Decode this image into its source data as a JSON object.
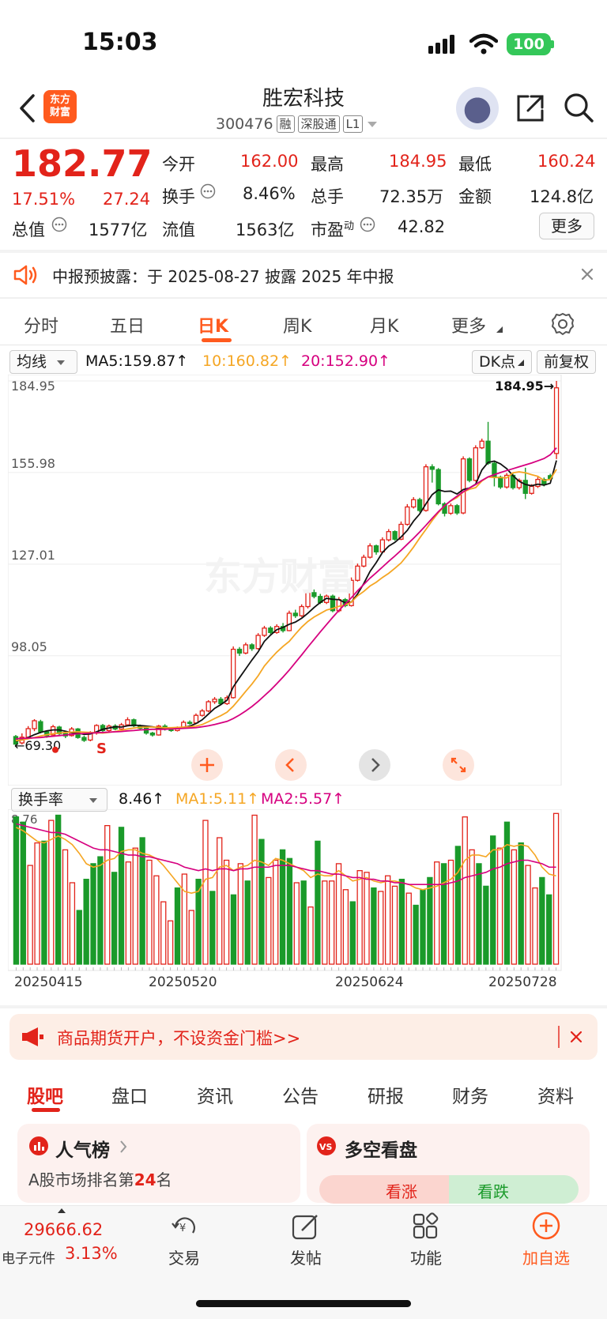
{
  "status": {
    "time": "15:03",
    "battery": "100"
  },
  "header": {
    "logo_text": "东方财富",
    "stock_name": "胜宏科技",
    "stock_code": "300476",
    "tags": [
      "融",
      "深股通",
      "L1"
    ]
  },
  "quote": {
    "price": "182.77",
    "change_pct": "17.51%",
    "change_amt": "27.24",
    "fields": [
      {
        "label": "今开",
        "value": "162.00",
        "color": "red"
      },
      {
        "label": "最高",
        "value": "184.95",
        "color": "red"
      },
      {
        "label": "最低",
        "value": "160.24",
        "color": "red"
      },
      {
        "label": "换手",
        "value": "8.46%",
        "color": "black"
      },
      {
        "label": "总手",
        "value": "72.35万",
        "color": "black"
      },
      {
        "label": "金额",
        "value": "124.8亿",
        "color": "black"
      },
      {
        "label": "总值",
        "value": "1577亿",
        "color": "black"
      },
      {
        "label": "流值",
        "value": "1563亿",
        "color": "black"
      },
      {
        "label": "市盈",
        "value": "42.82",
        "color": "black"
      }
    ],
    "pe_superscript": "动",
    "more_label": "更多"
  },
  "notice": {
    "text": "中报预披露：于 2025-08-27 披露 2025 年中报"
  },
  "kline_tabs": [
    "分时",
    "五日",
    "日K",
    "周K",
    "月K",
    "更多"
  ],
  "kline_active": 2,
  "ma_row": {
    "ma_select": "均线",
    "ma5": "MA5:159.87↑",
    "ma10": "10:160.82↑",
    "ma20": "20:152.90↑",
    "dk_label": "DK点",
    "adjust_label": "前复权"
  },
  "colors": {
    "up": "#e2231a",
    "down": "#1a9a2a",
    "ma5": "#111111",
    "ma10": "#f5a623",
    "ma20": "#d6007f",
    "accent": "#ff5a1e"
  },
  "chart_data": [
    {
      "type": "candlestick",
      "y_ticks": [
        "184.95",
        "155.98",
        "127.01",
        "98.05"
      ],
      "ylim": [
        70.0,
        184.95
      ],
      "max_label": "184.95→",
      "min_label": "69.30",
      "min_label_prefix": "←",
      "ohlc": [
        [
          72.5,
          70.1,
          73.0,
          69.3
        ],
        [
          70.5,
          72.3,
          73.5,
          70.0
        ],
        [
          72.3,
          75.0,
          75.8,
          71.6
        ],
        [
          75.0,
          77.5,
          78.0,
          74.2
        ],
        [
          77.2,
          74.0,
          77.8,
          73.5
        ],
        [
          74.0,
          72.8,
          74.5,
          72.1
        ],
        [
          73.0,
          75.6,
          76.2,
          72.6
        ],
        [
          75.5,
          73.4,
          75.9,
          72.9
        ],
        [
          73.4,
          72.7,
          74.0,
          72.0
        ],
        [
          72.8,
          74.9,
          75.5,
          72.5
        ],
        [
          74.9,
          72.2,
          75.2,
          71.8
        ],
        [
          72.2,
          71.3,
          72.8,
          70.8
        ],
        [
          71.4,
          73.6,
          74.2,
          71.0
        ],
        [
          73.6,
          76.0,
          76.4,
          73.1
        ],
        [
          76.0,
          74.4,
          76.5,
          74.0
        ],
        [
          74.4,
          75.8,
          76.3,
          74.0
        ],
        [
          75.8,
          74.9,
          76.4,
          74.5
        ],
        [
          74.9,
          76.2,
          76.8,
          74.6
        ],
        [
          76.2,
          77.8,
          78.6,
          75.8
        ],
        [
          77.8,
          75.9,
          78.2,
          75.5
        ],
        [
          75.9,
          75.1,
          76.3,
          74.6
        ],
        [
          75.1,
          73.6,
          75.5,
          73.1
        ],
        [
          73.6,
          73.0,
          74.0,
          72.5
        ],
        [
          73.0,
          75.8,
          76.2,
          72.8
        ],
        [
          75.8,
          74.9,
          76.4,
          74.4
        ],
        [
          74.9,
          74.4,
          75.4,
          74.0
        ],
        [
          74.4,
          75.3,
          75.7,
          74.1
        ],
        [
          75.3,
          77.0,
          77.6,
          75.0
        ],
        [
          77.0,
          76.8,
          77.6,
          76.2
        ],
        [
          76.8,
          79.2,
          79.8,
          76.6
        ],
        [
          79.2,
          80.6,
          81.2,
          78.8
        ],
        [
          80.6,
          83.5,
          84.0,
          80.2
        ],
        [
          83.5,
          84.3,
          85.0,
          82.8
        ],
        [
          84.3,
          82.9,
          85.0,
          82.4
        ],
        [
          82.9,
          84.8,
          85.5,
          82.5
        ],
        [
          84.8,
          100.1,
          101.0,
          84.5
        ],
        [
          100.1,
          98.9,
          100.8,
          98.0
        ],
        [
          98.9,
          101.5,
          102.2,
          98.5
        ],
        [
          101.5,
          100.3,
          102.0,
          99.6
        ],
        [
          100.3,
          104.5,
          105.2,
          100.0
        ],
        [
          104.5,
          106.8,
          107.5,
          104.0
        ],
        [
          106.8,
          105.4,
          107.4,
          104.9
        ],
        [
          105.4,
          107.3,
          108.0,
          105.0
        ],
        [
          107.3,
          106.0,
          108.4,
          105.4
        ],
        [
          106.0,
          111.5,
          112.3,
          105.8
        ],
        [
          111.5,
          110.7,
          112.6,
          110.0
        ],
        [
          110.7,
          113.6,
          114.3,
          110.3
        ],
        [
          113.6,
          118.0,
          118.8,
          113.0
        ],
        [
          118.0,
          116.8,
          119.0,
          116.2
        ],
        [
          116.8,
          114.9,
          117.6,
          114.4
        ],
        [
          114.9,
          116.9,
          117.4,
          114.4
        ],
        [
          116.9,
          112.3,
          117.4,
          111.8
        ],
        [
          112.3,
          115.8,
          116.6,
          111.8
        ],
        [
          115.8,
          113.9,
          116.3,
          113.4
        ],
        [
          113.9,
          121.9,
          122.8,
          113.6
        ],
        [
          121.9,
          126.4,
          127.2,
          121.5
        ],
        [
          126.4,
          129.2,
          130.0,
          126.0
        ],
        [
          129.2,
          132.8,
          133.6,
          128.8
        ],
        [
          132.8,
          130.9,
          133.2,
          130.0
        ],
        [
          130.9,
          134.7,
          135.5,
          130.5
        ],
        [
          134.7,
          137.3,
          138.1,
          134.2
        ],
        [
          137.3,
          134.9,
          137.7,
          134.4
        ],
        [
          134.9,
          139.6,
          140.5,
          134.6
        ],
        [
          139.6,
          145.1,
          146.0,
          139.2
        ],
        [
          145.1,
          147.4,
          148.2,
          144.6
        ],
        [
          147.4,
          144.0,
          148.0,
          143.4
        ],
        [
          144.0,
          157.8,
          158.6,
          143.6
        ],
        [
          157.8,
          157.0,
          158.6,
          152.8
        ],
        [
          156.9,
          146.1,
          157.4,
          145.6
        ],
        [
          146.1,
          143.1,
          146.6,
          142.1
        ],
        [
          143.1,
          145.5,
          146.2,
          142.6
        ],
        [
          145.5,
          143.2,
          146.0,
          142.6
        ],
        [
          143.2,
          160.3,
          161.1,
          142.8
        ],
        [
          160.3,
          153.5,
          160.8,
          152.9
        ],
        [
          153.5,
          163.8,
          164.6,
          153.1
        ],
        [
          163.8,
          165.9,
          166.7,
          163.4
        ],
        [
          165.9,
          158.9,
          172.0,
          158.4
        ],
        [
          158.9,
          154.5,
          159.5,
          151.6
        ],
        [
          154.5,
          151.4,
          155.0,
          150.8
        ],
        [
          151.4,
          155.1,
          155.8,
          150.9
        ],
        [
          155.1,
          151.2,
          155.6,
          150.6
        ],
        [
          151.2,
          153.5,
          154.1,
          150.6
        ],
        [
          153.5,
          149.4,
          157.5,
          147.6
        ],
        [
          149.4,
          151.6,
          152.3,
          149.0
        ],
        [
          151.6,
          153.8,
          154.6,
          151.1
        ],
        [
          153.8,
          152.3,
          154.4,
          151.6
        ],
        [
          155.0,
          154.1,
          155.6,
          153.5
        ],
        [
          162.0,
          182.77,
          184.95,
          160.24
        ]
      ],
      "ma5": [
        71.0,
        71.5,
        72.2,
        73.1,
        73.8,
        74.3,
        74.6,
        74.6,
        74.2,
        73.7,
        73.6,
        73.2,
        73.3,
        74.0,
        74.8,
        75.2,
        75.6,
        75.5,
        75.9,
        76.1,
        76.0,
        75.8,
        75.6,
        75.2,
        75.1,
        75.0,
        75.2,
        75.4,
        75.8,
        76.6,
        77.8,
        79.6,
        81.4,
        82.6,
        84.0,
        88.2,
        91.1,
        93.9,
        96.7,
        99.3,
        102.6,
        104.6,
        106.3,
        107.0,
        108.0,
        108.7,
        109.9,
        111.5,
        113.3,
        114.9,
        116.2,
        115.9,
        115.8,
        114.8,
        115.0,
        117.6,
        120.9,
        124.7,
        127.5,
        130.7,
        132.7,
        133.9,
        135.6,
        137.7,
        140.6,
        142.9,
        146.1,
        149.0,
        150.5,
        150.0,
        150.1,
        149.2,
        150.6,
        151.1,
        152.3,
        156.8,
        159.2,
        159.6,
        158.7,
        157.2,
        155.0,
        153.2,
        152.2,
        151.8,
        152.3,
        152.0,
        152.6,
        159.8
      ],
      "ma10": [
        71.2,
        71.4,
        71.8,
        72.2,
        72.7,
        73.1,
        73.4,
        73.6,
        73.8,
        73.9,
        74.0,
        73.9,
        73.8,
        73.7,
        73.6,
        73.8,
        74.1,
        74.5,
        74.9,
        75.2,
        75.4,
        75.5,
        75.5,
        75.4,
        75.3,
        75.3,
        75.4,
        75.5,
        75.6,
        75.8,
        76.3,
        77.2,
        78.2,
        79.1,
        80.2,
        82.1,
        84.4,
        86.8,
        89.1,
        91.7,
        94.8,
        97.1,
        99.2,
        101.0,
        102.6,
        104.9,
        107.1,
        108.9,
        110.3,
        111.4,
        112.5,
        113.0,
        113.7,
        114.1,
        115.0,
        117.0,
        118.4,
        120.1,
        121.3,
        122.8,
        124.1,
        125.7,
        127.4,
        129.8,
        132.4,
        135.3,
        138.0,
        140.8,
        143.3,
        145.5,
        147.0,
        148.1,
        149.8,
        150.7,
        151.2,
        153.3,
        154.6,
        154.4,
        154.4,
        154.3,
        155.9,
        156.2,
        155.9,
        155.3,
        154.8,
        153.5,
        153.8,
        157.0
      ],
      "ma20": [
        71.8,
        71.9,
        72.0,
        72.1,
        72.2,
        72.4,
        72.6,
        72.8,
        73.0,
        73.2,
        73.4,
        73.5,
        73.6,
        73.7,
        73.8,
        73.9,
        74.0,
        74.1,
        74.3,
        74.4,
        74.6,
        74.7,
        74.8,
        74.8,
        74.8,
        74.9,
        75.0,
        75.1,
        75.2,
        75.3,
        75.6,
        75.9,
        76.3,
        76.8,
        77.3,
        78.2,
        79.3,
        80.6,
        82.0,
        83.6,
        85.4,
        87.2,
        89.2,
        91.3,
        93.5,
        95.9,
        98.3,
        100.8,
        103.2,
        105.6,
        107.9,
        110.2,
        112.4,
        114.4,
        116.4,
        118.6,
        120.6,
        122.6,
        124.3,
        126.1,
        127.9,
        129.6,
        131.4,
        133.3,
        135.2,
        137.2,
        139.3,
        141.5,
        143.6,
        145.5,
        147.1,
        148.5,
        149.9,
        151.1,
        152.2,
        153.5,
        154.6,
        155.3,
        156.0,
        156.6,
        157.2,
        157.8,
        158.4,
        159.0,
        159.7,
        160.4,
        161.6,
        163.8
      ]
    },
    {
      "type": "bar",
      "indicator_select": "换手率",
      "value_label": "8.46↑",
      "ma1_label": "MA1:5.11↑",
      "ma2_label": "MA2:5.57↑",
      "y_max_label": "8.76",
      "ylim": [
        0,
        8.76
      ],
      "x_labels": [
        "20250415",
        "20250520",
        "20250624",
        "20250728"
      ],
      "values": [
        8.5,
        8.2,
        5.7,
        7.0,
        7.1,
        8.3,
        8.6,
        6.6,
        4.7,
        3.1,
        4.9,
        5.8,
        6.2,
        8.0,
        5.3,
        7.9,
        5.9,
        6.7,
        7.3,
        6.0,
        5.1,
        3.6,
        2.5,
        4.4,
        5.2,
        3.1,
        4.9,
        8.3,
        4.2,
        7.3,
        6.0,
        4.0,
        5.8,
        4.8,
        8.6,
        7.2,
        5.0,
        6.0,
        6.6,
        6.1,
        4.7,
        4.8,
        3.3,
        7.1,
        4.8,
        4.8,
        5.8,
        4.3,
        3.6,
        5.4,
        5.3,
        4.4,
        4.2,
        5.1,
        4.5,
        4.9,
        4.1,
        3.4,
        4.3,
        5.0,
        5.9,
        5.8,
        6.0,
        6.8,
        8.5,
        6.6,
        5.8,
        4.5,
        7.4,
        6.7,
        8.2,
        6.6,
        7.0,
        5.7,
        4.4,
        5.0,
        4.0,
        8.7
      ],
      "ma1": [
        7.9,
        7.7,
        7.4,
        7.1,
        7.0,
        7.2,
        7.4,
        7.2,
        6.9,
        6.4,
        5.8,
        5.6,
        5.7,
        6.0,
        6.1,
        6.5,
        6.6,
        6.6,
        6.4,
        6.3,
        6.1,
        5.7,
        5.2,
        4.7,
        4.2,
        4.1,
        4.2,
        4.9,
        5.0,
        5.6,
        5.7,
        5.4,
        5.6,
        5.7,
        6.0,
        5.9,
        5.7,
        6.1,
        6.0,
        5.8,
        5.6,
        5.4,
        5.0,
        5.2,
        5.1,
        5.1,
        5.4,
        5.1,
        4.8,
        4.9,
        5.0,
        4.8,
        4.7,
        4.8,
        4.8,
        4.7,
        4.6,
        4.4,
        4.3,
        4.4,
        4.5,
        4.7,
        4.9,
        5.3,
        6.0,
        6.3,
        6.3,
        6.2,
        6.6,
        6.6,
        6.9,
        6.8,
        6.9,
        6.8,
        6.3,
        5.6,
        5.2,
        5.1
      ],
      "ma2": [
        8.1,
        8.0,
        7.9,
        7.8,
        7.7,
        7.6,
        7.6,
        7.5,
        7.3,
        7.1,
        6.9,
        6.7,
        6.6,
        6.6,
        6.5,
        6.4,
        6.3,
        6.3,
        6.2,
        6.2,
        6.1,
        6.0,
        5.9,
        5.8,
        5.6,
        5.5,
        5.4,
        5.5,
        5.4,
        5.5,
        5.5,
        5.4,
        5.5,
        5.5,
        5.6,
        5.6,
        5.6,
        5.7,
        5.7,
        5.7,
        5.6,
        5.5,
        5.4,
        5.4,
        5.3,
        5.2,
        5.2,
        5.1,
        5.0,
        5.0,
        4.9,
        4.9,
        4.8,
        4.8,
        4.7,
        4.7,
        4.6,
        4.6,
        4.6,
        4.6,
        4.6,
        4.6,
        4.7,
        4.8,
        5.0,
        5.1,
        5.2,
        5.3,
        5.5,
        5.6,
        5.8,
        5.9,
        6.0,
        6.0,
        5.9,
        5.8,
        5.6,
        5.6
      ]
    }
  ],
  "ad_banner": {
    "text": "商品期货开户，不设资金门槛>>"
  },
  "bottom_tabs": [
    "股吧",
    "盘口",
    "资讯",
    "公告",
    "研报",
    "财务",
    "资料"
  ],
  "bottom_active": 0,
  "cards": {
    "popularity_title": "人气榜",
    "popularity_rank_prefix": "A股市场排名第",
    "popularity_rank": "24",
    "popularity_rank_suffix": "名",
    "sentiment_title": "多空看盘",
    "bull_label": "看涨",
    "bear_label": "看跌"
  },
  "nav": {
    "index_value": "29666.62",
    "sector_name": "电子元件",
    "sector_change": "3.13%",
    "items": [
      "交易",
      "发帖",
      "功能",
      "加自选"
    ]
  }
}
